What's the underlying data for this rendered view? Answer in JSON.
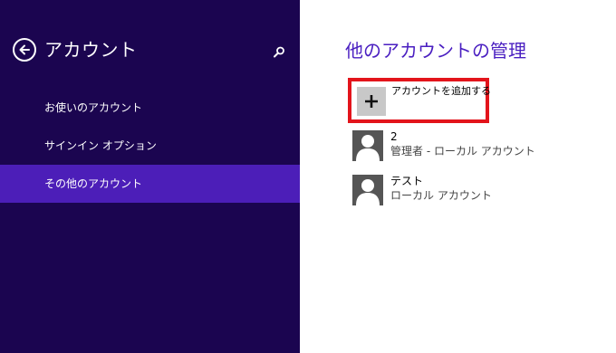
{
  "sidebar": {
    "title": "アカウント",
    "back_icon": "back-arrow-icon",
    "search_icon": "search-icon",
    "items": [
      {
        "label": "お使いのアカウント",
        "selected": false
      },
      {
        "label": "サインイン オプション",
        "selected": false
      },
      {
        "label": "その他のアカウント",
        "selected": true
      }
    ]
  },
  "main": {
    "title": "他のアカウントの管理",
    "add_account_label": "アカウントを追加する",
    "add_icon": "plus-icon",
    "accounts": [
      {
        "name": "2",
        "type": "管理者 - ローカル アカウント",
        "icon": "user-avatar-icon"
      },
      {
        "name": "テスト",
        "type": "ローカル アカウント",
        "icon": "user-avatar-icon"
      }
    ]
  },
  "colors": {
    "sidebar_bg": "#1b0550",
    "selected_bg": "#4c1eb8",
    "title_accent": "#4a1fc1",
    "highlight_border": "#e3141b"
  }
}
